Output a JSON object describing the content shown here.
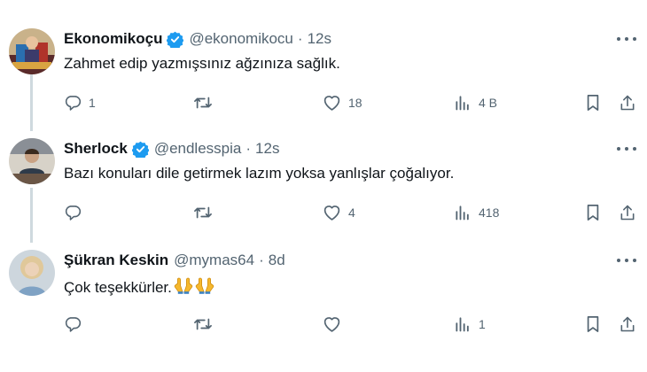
{
  "tweets": [
    {
      "name": "Ekonomikoçu",
      "verified": true,
      "handle": "@ekonomikocu",
      "time": "12s",
      "text": "Zahmet edip yazmışsınız ağzınıza sağlık.",
      "stats": {
        "replies": "1",
        "retweets": "",
        "likes": "18",
        "views": "4 B"
      }
    },
    {
      "name": "Sherlock",
      "verified": true,
      "handle": "@endlesspia",
      "time": "12s",
      "text": "Bazı konuları dile getirmek lazım yoksa yanlışlar çoğalıyor.",
      "stats": {
        "replies": "",
        "retweets": "",
        "likes": "4",
        "views": "418"
      }
    },
    {
      "name": "Şükran Keskin",
      "verified": false,
      "handle": "@mymas64",
      "time": "8d",
      "text": "Çok teşekkürler.",
      "stats": {
        "replies": "",
        "retweets": "",
        "likes": "",
        "views": "1"
      }
    }
  ],
  "separator": "·",
  "colors": {
    "accent": "#1d9bf0",
    "muted": "#536471",
    "text": "#0f1419",
    "thread": "#cfd9de"
  },
  "icons": [
    "verified-badge-icon",
    "more-icon",
    "reply-icon",
    "retweet-icon",
    "like-icon",
    "views-icon",
    "bookmark-icon",
    "share-icon",
    "folded-hands-emoji"
  ]
}
